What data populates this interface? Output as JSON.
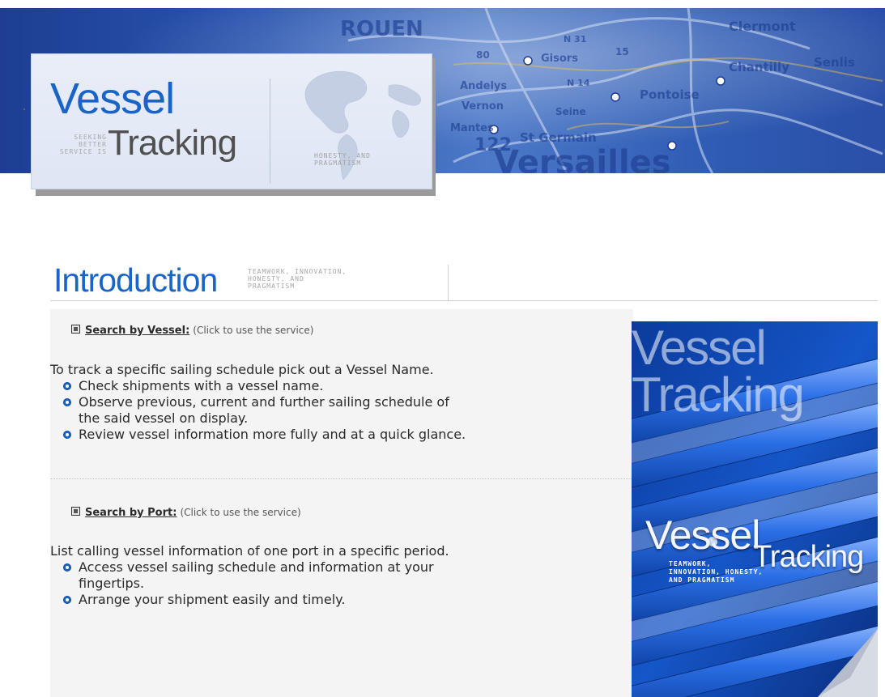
{
  "header": {
    "logo": {
      "title_top": "Vessel",
      "title_bottom": "Tracking",
      "slogan_lines": [
        "Seeking",
        "better",
        "service is"
      ],
      "motto_lines": [
        "Honesty, and",
        "pragmatism"
      ]
    },
    "map_labels": [
      "ROUEN",
      "Clermont",
      "Gisors",
      "Chantilly",
      "Senlis",
      "Pontoise",
      "Andelys",
      "Vernon",
      "Seine",
      "Mantes",
      "St Germain",
      "Versailles",
      "N 31",
      "N 14",
      "80",
      "122",
      "15"
    ]
  },
  "introduction": {
    "title": "Introduction",
    "tagline_lines": [
      "Teamwork, innovation,",
      "honesty, and",
      "pragmatism"
    ]
  },
  "sections": [
    {
      "link_label": "Search by Vessel:",
      "hint": "(Click to use the service)",
      "description": "To track a specific sailing schedule pick out a Vessel Name.",
      "bullets": [
        "Check shipments with a vessel name.",
        "Observe previous, current and further sailing schedule of",
        "Review vessel information more fully and at a quick glance."
      ],
      "bullet_continuation": "the said vessel on display."
    },
    {
      "link_label": "Search by Port:",
      "hint": "(Click to use the service)",
      "description": "List calling vessel information of one port in a specific period.",
      "bullets": [
        "Access vessel sailing schedule and information at your",
        "Arrange your shipment easily and timely."
      ],
      "bullet_continuation": "fingertips."
    }
  ],
  "side_image": {
    "title_top": "Vessel",
    "title_bottom": "Tracking",
    "overlay_top": "Vessel",
    "overlay_bottom": "Tracking",
    "tagline_lines": [
      "Teamwork,",
      "innovation, honesty,",
      "and pragmatism"
    ]
  },
  "colors": {
    "brand_blue": "#1a64c8",
    "banner_blue": "#2a55b0",
    "panel_bg": "#f4f4f4"
  }
}
